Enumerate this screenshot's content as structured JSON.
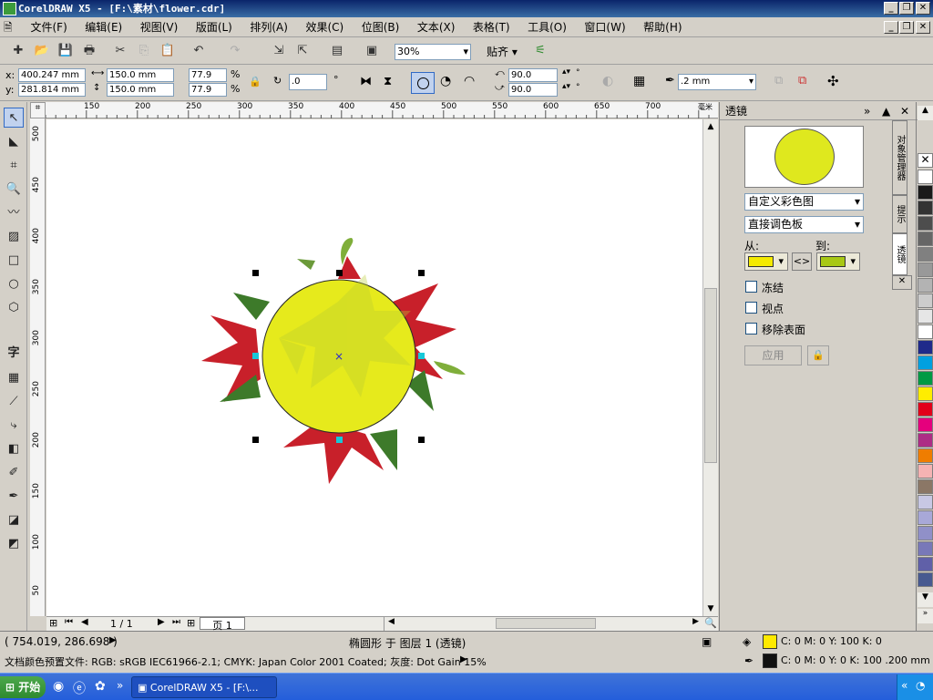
{
  "window": {
    "title": "CorelDRAW X5 - [F:\\素材\\flower.cdr]"
  },
  "menu": [
    "文件(F)",
    "编辑(E)",
    "视图(V)",
    "版面(L)",
    "排列(A)",
    "效果(C)",
    "位图(B)",
    "文本(X)",
    "表格(T)",
    "工具(O)",
    "窗口(W)",
    "帮助(H)"
  ],
  "toolbar": {
    "zoom": "30%",
    "snap": "贴齐"
  },
  "props": {
    "x_label": "x:",
    "y_label": "y:",
    "x": "400.247 mm",
    "y": "281.814 mm",
    "w": "150.0 mm",
    "h": "150.0 mm",
    "sx": "77.9",
    "sy": "77.9",
    "pct": "%",
    "angle": ".0",
    "deg": "°",
    "start_angle": "90.0",
    "end_angle": "90.0",
    "outline": ".2 mm"
  },
  "ruler": {
    "h_ticks": [
      "150",
      "200",
      "250",
      "300",
      "350",
      "400",
      "450",
      "500",
      "550",
      "600",
      "650",
      "700"
    ],
    "h_unit": "毫米",
    "v_ticks": [
      "500",
      "450",
      "400",
      "350",
      "300",
      "250",
      "200",
      "150",
      "100",
      "50"
    ]
  },
  "page_nav": {
    "count": "1 / 1",
    "tab": "页 1"
  },
  "docker": {
    "title": "透镜",
    "lens_type": "自定义彩色图",
    "palette_mode": "直接调色板",
    "from_label": "从:",
    "to_label": "到:",
    "from_color": "#f4ea00",
    "to_color": "#a8c814",
    "swap": "<>",
    "freeze": "冻结",
    "viewpoint": "视点",
    "remove_face": "移除表面",
    "apply": "应用",
    "tabs": [
      "对象管理器",
      "提示",
      "透镜"
    ]
  },
  "palette": [
    "#ffffff",
    "#1a1a1a",
    "#333333",
    "#4d4d4d",
    "#666666",
    "#808080",
    "#999999",
    "#b3b3b3",
    "#cccccc",
    "#e6e6e6",
    "#ffffff",
    "#1f2a8a",
    "#00a0e0",
    "#009a44",
    "#ffed00",
    "#e2001a",
    "#e5007d",
    "#ad2d85",
    "#ef7d00",
    "#f5b3b3",
    "#8b7766",
    "#c8c8e4",
    "#a8a8d8",
    "#9090c8",
    "#7878b8",
    "#6060a8",
    "#485a90"
  ],
  "status": {
    "coords": "( 754.019, 286.698 )",
    "object": "椭圆形 于 图层 1 (透镜)",
    "fill": "C: 0 M: 0 Y: 100 K: 0",
    "fill_color": "#ffea00",
    "outline": "C: 0 M: 0 Y: 0 K: 100  .200 mm",
    "outline_color": "#111111",
    "profile": "文档颜色预置文件: RGB: sRGB IEC61966-2.1; CMYK: Japan Color 2001 Coated; 灰度: Dot Gain 15%"
  },
  "taskbar": {
    "start": "开始",
    "app": "CorelDRAW X5 - [F:\\..."
  }
}
